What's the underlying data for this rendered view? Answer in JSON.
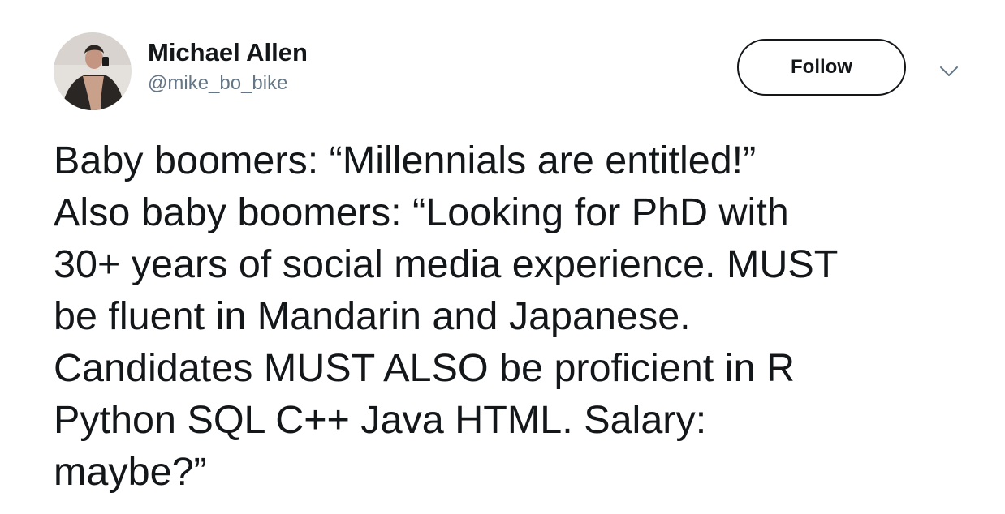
{
  "author": {
    "name": "Michael Allen",
    "handle": "@mike_bo_bike"
  },
  "follow_button": {
    "label": "Follow"
  },
  "menu": {
    "icon": "chevron-down-icon"
  },
  "tweet": {
    "text": "Baby boomers:  “Millennials are entitled!”\nAlso baby boomers:  “Looking for PhD with\n30+ years of social media experience.  MUST\nbe fluent in Mandarin and Japanese.\nCandidates MUST ALSO be proficient in R\nPython SQL C++ Java HTML.  Salary:\nmaybe?”"
  },
  "colors": {
    "text": "#14171a",
    "secondary": "#657786",
    "background": "#ffffff"
  }
}
